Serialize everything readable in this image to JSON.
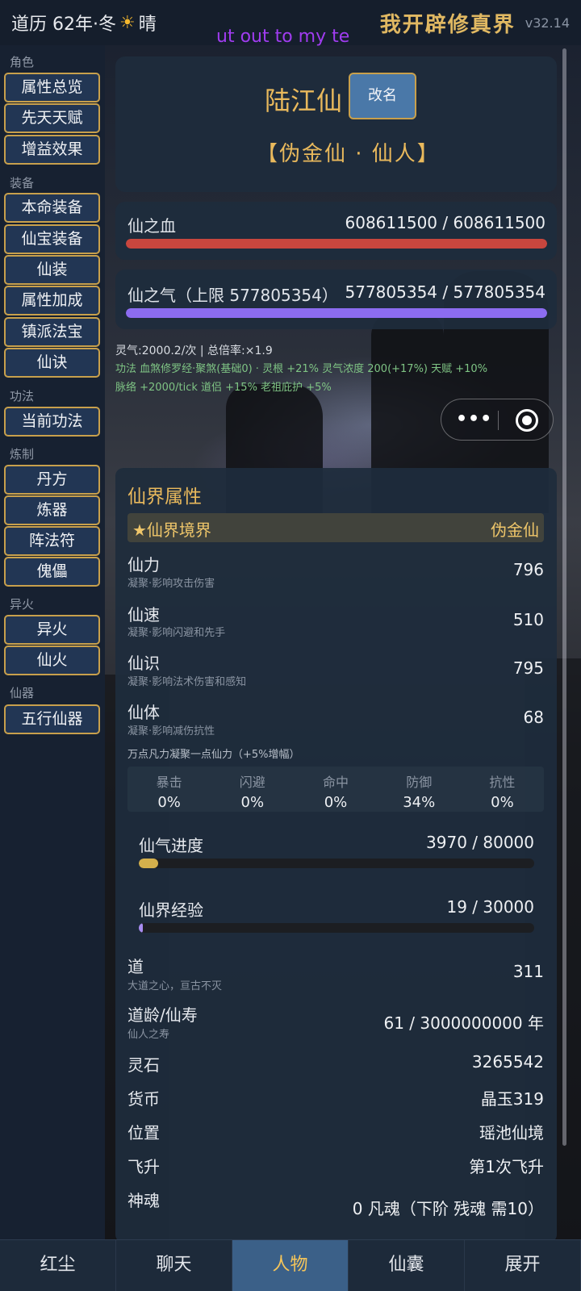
{
  "topbar": {
    "date": "道历 62年·冬",
    "weather_icon": "sun-icon",
    "weather": "晴",
    "app_title": "我开辟修真界",
    "version": "v32.14",
    "marquee": "ut out to my te"
  },
  "sidebar": {
    "sections": [
      {
        "title": "角色",
        "items": [
          "属性总览",
          "先天天赋",
          "增益效果"
        ]
      },
      {
        "title": "装备",
        "items": [
          "本命装备",
          "仙宝装备",
          "仙装",
          "属性加成",
          "镇派法宝",
          "仙诀"
        ]
      },
      {
        "title": "功法",
        "items": [
          "当前功法"
        ]
      },
      {
        "title": "炼制",
        "items": [
          "丹方",
          "炼器",
          "阵法符",
          "傀儡"
        ]
      },
      {
        "title": "异火",
        "items": [
          "异火",
          "仙火"
        ]
      },
      {
        "title": "仙器",
        "items": [
          "五行仙器"
        ]
      }
    ]
  },
  "profile": {
    "name": "陆江仙",
    "rename_label": "改名",
    "rank": "【伪金仙 · 仙人】"
  },
  "blood": {
    "label": "仙之血",
    "current": "608611500",
    "max": "608611500",
    "value_text": "608611500 / 608611500",
    "fill": 1.0,
    "color": "#c8463e"
  },
  "qi": {
    "label": "仙之气（上限 577805354）",
    "value_text": "577805354 / 577805354",
    "fill": 1.0,
    "color": "#8c6cf0"
  },
  "cultivation_lines": {
    "line1": "灵气:2000.2/次 | 总倍率:×1.9",
    "line2": "功法 血煞修罗经·聚煞(基础0) · 灵根 +21%   灵气浓度 200(+17%)   天赋 +10%",
    "line3": "脉络 +2000/tick   道侣 +15%   老祖庇护 +5%"
  },
  "capsule": {
    "more_icon": "more-dots-icon",
    "close_icon": "target-circle-icon",
    "dots": "•••"
  },
  "attributes": {
    "title": "仙界属性",
    "realm_label": "★仙界境界",
    "realm_value": "伪金仙",
    "items": [
      {
        "name": "仙力",
        "desc": "凝聚·影响攻击伤害",
        "value": "796"
      },
      {
        "name": "仙速",
        "desc": "凝聚·影响闪避和先手",
        "value": "510"
      },
      {
        "name": "仙识",
        "desc": "凝聚·影响法术伤害和感知",
        "value": "795"
      },
      {
        "name": "仙体",
        "desc": "凝聚·影响减伤抗性",
        "value": "68"
      }
    ],
    "note": "万点凡力凝聚一点仙力（+5%增幅）",
    "stats": [
      {
        "label": "暴击",
        "value": "0%"
      },
      {
        "label": "闪避",
        "value": "0%"
      },
      {
        "label": "命中",
        "value": "0%"
      },
      {
        "label": "防御",
        "value": "34%"
      },
      {
        "label": "抗性",
        "value": "0%"
      }
    ],
    "qi_progress": {
      "label": "仙气进度",
      "value_text": "3970 / 80000",
      "fill": 0.0496,
      "color": "#d4b04c"
    },
    "exp_progress": {
      "label": "仙界经验",
      "value_text": "19 / 30000",
      "fill": 0.0006,
      "color": "#a88cf0"
    }
  },
  "info": [
    {
      "name": "道",
      "desc": "大道之心，亘古不灭",
      "value": "311"
    },
    {
      "name": "道龄/仙寿",
      "desc": "仙人之寿",
      "value": "61 / 3000000000 年"
    },
    {
      "name": "灵石",
      "desc": "",
      "value": "3265542"
    },
    {
      "name": "货币",
      "desc": "",
      "value": "晶玉319"
    },
    {
      "name": "位置",
      "desc": "",
      "value": "瑶池仙境"
    },
    {
      "name": "飞升",
      "desc": "",
      "value": "第1次飞升"
    },
    {
      "name": "神魂",
      "desc": "",
      "value": "0  凡魂（下阶 残魂 需10）"
    }
  ],
  "bottom_nav": [
    "红尘",
    "聊天",
    "人物",
    "仙囊",
    "展开"
  ],
  "bottom_nav_active": 2
}
